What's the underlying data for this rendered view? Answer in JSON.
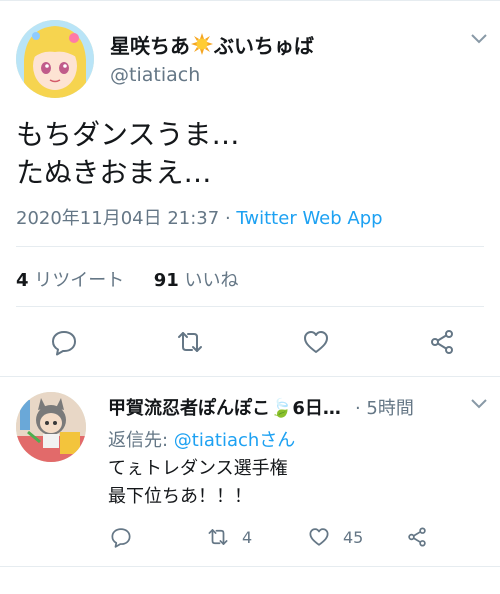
{
  "main_tweet": {
    "display_name_part1": "星咲ちあ",
    "display_name_emoji": "sun-emoji",
    "display_name_part2": "ぶいちゅば",
    "handle": "@tiatiach",
    "text": "もちダンスうま…\nたぬきおまえ…",
    "timestamp": "2020年11月04日 21:37",
    "separator": " · ",
    "source": "Twitter Web App",
    "retweet_count": "4",
    "retweet_label": " リツイート",
    "like_count": "91",
    "like_label": " いいね",
    "icons": [
      "reply-icon",
      "retweet-icon",
      "like-icon",
      "share-icon"
    ]
  },
  "reply": {
    "display_name": "甲賀流忍者ぽんぽこ🍃6日…",
    "time": "· 5時間",
    "reply_to_label": "返信先: ",
    "reply_to_handle": "@tiatiachさん",
    "text": "てぇトレダンス選手権\n最下位ちあ！！！",
    "retweet_count": "4",
    "like_count": "45"
  },
  "colors": {
    "accent": "#1da1f2",
    "text": "#14171a",
    "secondary": "#657786",
    "divider": "#e6ecf0"
  }
}
